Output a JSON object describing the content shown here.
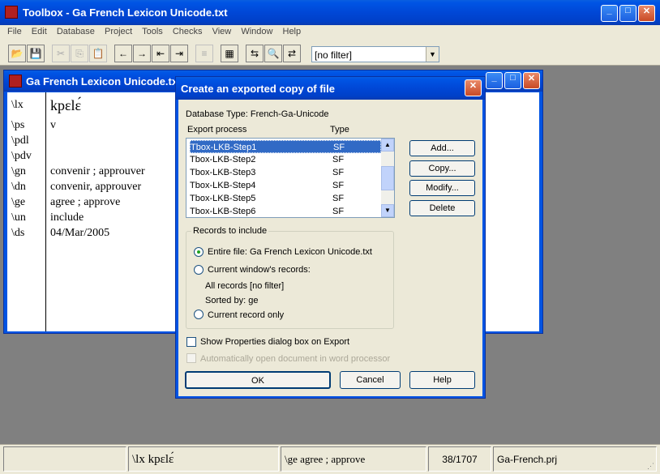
{
  "app": {
    "title": "Toolbox - Ga French Lexicon Unicode.txt",
    "menu": [
      "File",
      "Edit",
      "Database",
      "Project",
      "Tools",
      "Checks",
      "View",
      "Window",
      "Help"
    ],
    "filter_value": "[no filter]"
  },
  "doc": {
    "title": "Ga French Lexicon Unicode.txt",
    "fields": [
      {
        "marker": "\\lx",
        "value": "kpɛlɛ́"
      },
      {
        "marker": "\\ps",
        "value": "v"
      },
      {
        "marker": "\\pdl",
        "value": ""
      },
      {
        "marker": "\\pdv",
        "value": ""
      },
      {
        "marker": "\\gn",
        "value": "convenir ; approuver"
      },
      {
        "marker": "\\dn",
        "value": "convenir, approuver"
      },
      {
        "marker": "\\ge",
        "value": "agree ; approve"
      },
      {
        "marker": "\\un",
        "value": "include"
      },
      {
        "marker": "\\ds",
        "value": "04/Mar/2005"
      }
    ]
  },
  "dialog": {
    "title": "Create an exported copy of file",
    "db_type": "Database Type: French-Ga-Unicode",
    "col_process": "Export process",
    "col_type": "Type",
    "items": [
      {
        "name": "Tbox-LKB-Step1",
        "type": "SF",
        "selected": true
      },
      {
        "name": "Tbox-LKB-Step2",
        "type": "SF",
        "selected": false
      },
      {
        "name": "Tbox-LKB-Step3",
        "type": "SF",
        "selected": false
      },
      {
        "name": "Tbox-LKB-Step4",
        "type": "SF",
        "selected": false
      },
      {
        "name": "Tbox-LKB-Step5",
        "type": "SF",
        "selected": false
      },
      {
        "name": "Tbox-LKB-Step6",
        "type": "SF",
        "selected": false
      }
    ],
    "btn_add": "Add...",
    "btn_copy": "Copy...",
    "btn_modify": "Modify...",
    "btn_delete": "Delete",
    "records_group": "Records to include",
    "radio_entire": "Entire file: Ga French Lexicon Unicode.txt",
    "radio_window": "Current window's records:",
    "all_records": "All records [no filter]",
    "sorted_by": "Sorted by: ge",
    "radio_current": "Current record only",
    "chk_show_props": "Show Properties dialog box on Export",
    "chk_auto_open": "Automatically open document in word processor",
    "btn_ok": "OK",
    "btn_cancel": "Cancel",
    "btn_help": "Help"
  },
  "status": {
    "lx": "\\lx  kpɛlɛ́",
    "ge": "\\ge  agree ; approve",
    "count": "38/1707",
    "project": "Ga-French.prj"
  }
}
